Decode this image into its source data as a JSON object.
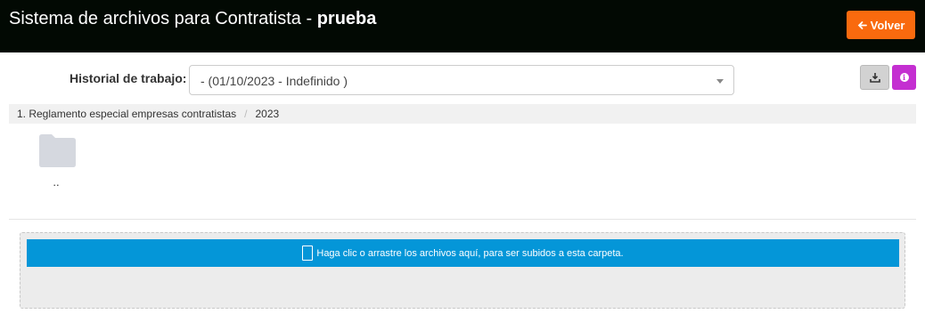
{
  "header": {
    "title": "Sistema de archivos para Contratista - ",
    "title_bold": "prueba",
    "back_button_label": "Volver"
  },
  "history": {
    "label": "Historial de trabajo:",
    "selected": "- (01/10/2023 - Indefinido )"
  },
  "toolbar": {
    "download_icon": "download-icon",
    "info_icon": "info-icon"
  },
  "breadcrumb": {
    "items": [
      "1. Reglamento especial empresas contratistas",
      "2023"
    ],
    "separator": "/"
  },
  "folders": [
    {
      "label": "..",
      "icon": "folder-icon"
    }
  ],
  "upload": {
    "text": "Haga clic o arrastre los archivos aquí, para ser subidos a esta carpeta."
  },
  "colors": {
    "header_bg": "#020903",
    "accent_orange": "#f96a0e",
    "info_purple": "#c42fd1",
    "upload_blue": "#0496d8"
  }
}
